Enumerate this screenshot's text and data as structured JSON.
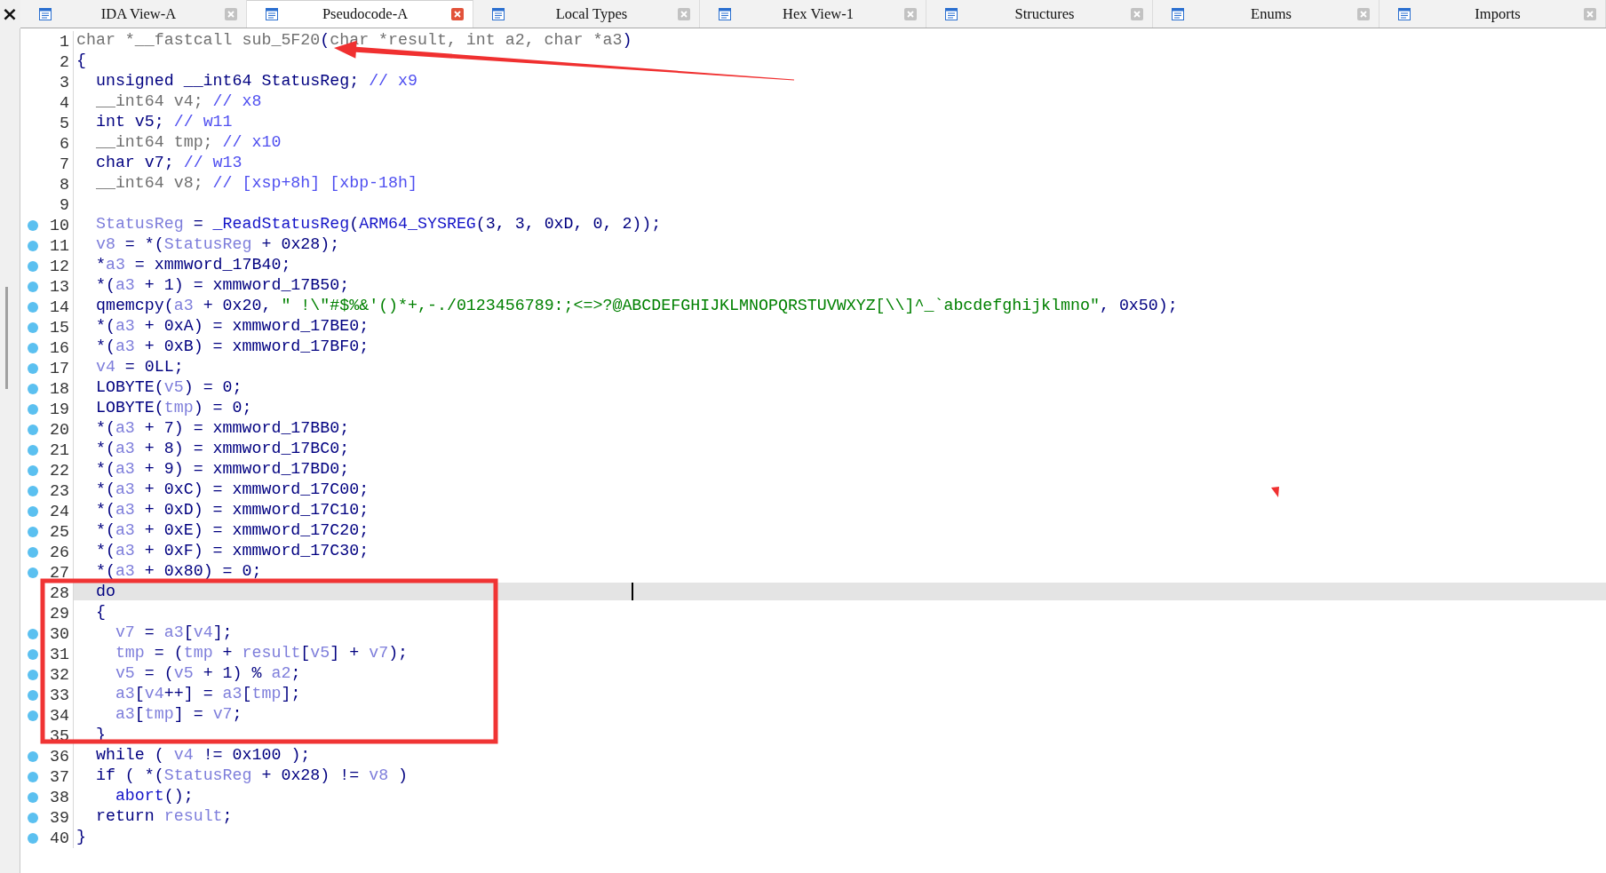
{
  "close_glyph": "×",
  "tabs": [
    {
      "label": "IDA View-A",
      "selected": false
    },
    {
      "label": "Pseudocode-A",
      "selected": true
    },
    {
      "label": "Local Types",
      "selected": false
    },
    {
      "label": "Hex View-1",
      "selected": false
    },
    {
      "label": "Structures",
      "selected": false
    },
    {
      "label": "Enums",
      "selected": false
    },
    {
      "label": "Imports",
      "selected": false
    }
  ],
  "lines": [
    {
      "number": "1",
      "marked": false,
      "selected": false,
      "tokens": [
        {
          "text": "char *__fastcall sub_5F20",
          "kind": "dim"
        },
        {
          "text": "(",
          "kind": "plain"
        },
        {
          "text": "char *result, int a2, char *a3",
          "kind": "dim"
        },
        {
          "text": ")",
          "kind": "plain"
        }
      ]
    },
    {
      "number": "2",
      "marked": false,
      "selected": false,
      "tokens": [
        {
          "text": "{",
          "kind": "plain"
        }
      ]
    },
    {
      "number": "3",
      "marked": false,
      "selected": false,
      "tokens": [
        {
          "text": "  unsigned __int64 StatusReg; ",
          "kind": "plain"
        },
        {
          "text": "// x9",
          "kind": "comment"
        }
      ]
    },
    {
      "number": "4",
      "marked": false,
      "selected": false,
      "tokens": [
        {
          "text": "  __int64 v4; ",
          "kind": "dim"
        },
        {
          "text": "// x8",
          "kind": "comment"
        }
      ]
    },
    {
      "number": "5",
      "marked": false,
      "selected": false,
      "tokens": [
        {
          "text": "  int v5; ",
          "kind": "plain"
        },
        {
          "text": "// w11",
          "kind": "comment"
        }
      ]
    },
    {
      "number": "6",
      "marked": false,
      "selected": false,
      "tokens": [
        {
          "text": "  __int64 tmp; ",
          "kind": "dim"
        },
        {
          "text": "// x10",
          "kind": "comment"
        }
      ]
    },
    {
      "number": "7",
      "marked": false,
      "selected": false,
      "tokens": [
        {
          "text": "  char v7; ",
          "kind": "plain"
        },
        {
          "text": "// w13",
          "kind": "comment"
        }
      ]
    },
    {
      "number": "8",
      "marked": false,
      "selected": false,
      "tokens": [
        {
          "text": "  __int64 v8; ",
          "kind": "dim"
        },
        {
          "text": "// [xsp+8h] [xbp-18h]",
          "kind": "comment"
        }
      ]
    },
    {
      "number": "9",
      "marked": false,
      "selected": false
    },
    {
      "number": "10",
      "marked": true,
      "selected": false,
      "tokens": [
        {
          "text": "  StatusReg",
          "kind": "var"
        },
        {
          "text": " = ",
          "kind": "plain"
        },
        {
          "text": "_ReadStatusReg",
          "kind": "func"
        },
        {
          "text": "(",
          "kind": "plain"
        },
        {
          "text": "ARM64_SYSREG",
          "kind": "func"
        },
        {
          "text": "(3, 3, 0xD, 0, 2));",
          "kind": "plain"
        }
      ]
    },
    {
      "number": "11",
      "marked": true,
      "selected": false,
      "tokens": [
        {
          "text": "  v8",
          "kind": "var"
        },
        {
          "text": " = *(",
          "kind": "plain"
        },
        {
          "text": "StatusReg",
          "kind": "var"
        },
        {
          "text": " + 0x28);",
          "kind": "plain"
        }
      ]
    },
    {
      "number": "12",
      "marked": true,
      "selected": false,
      "tokens": [
        {
          "text": "  *",
          "kind": "plain"
        },
        {
          "text": "a3",
          "kind": "var"
        },
        {
          "text": " = xmmword_17B40;",
          "kind": "plain"
        }
      ]
    },
    {
      "number": "13",
      "marked": true,
      "selected": false,
      "tokens": [
        {
          "text": "  *(",
          "kind": "plain"
        },
        {
          "text": "a3",
          "kind": "var"
        },
        {
          "text": " + 1) = xmmword_17B50;",
          "kind": "plain"
        }
      ]
    },
    {
      "number": "14",
      "marked": true,
      "selected": false,
      "tokens": [
        {
          "text": "  qmemcpy(",
          "kind": "plain"
        },
        {
          "text": "a3",
          "kind": "var"
        },
        {
          "text": " + 0x20, ",
          "kind": "plain"
        },
        {
          "text": "\" !\\\"#$%&'()*+,-./0123456789:;<=>?@ABCDEFGHIJKLMNOPQRSTUVWXYZ[\\\\]^_`abcdefghijklmno\"",
          "kind": "str"
        },
        {
          "text": ", 0x50);",
          "kind": "plain"
        }
      ]
    },
    {
      "number": "15",
      "marked": true,
      "selected": false,
      "tokens": [
        {
          "text": "  *(",
          "kind": "plain"
        },
        {
          "text": "a3",
          "kind": "var"
        },
        {
          "text": " + 0xA) = xmmword_17BE0;",
          "kind": "plain"
        }
      ]
    },
    {
      "number": "16",
      "marked": true,
      "selected": false,
      "tokens": [
        {
          "text": "  *(",
          "kind": "plain"
        },
        {
          "text": "a3",
          "kind": "var"
        },
        {
          "text": " + 0xB) = xmmword_17BF0;",
          "kind": "plain"
        }
      ]
    },
    {
      "number": "17",
      "marked": true,
      "selected": false,
      "tokens": [
        {
          "text": "  v4",
          "kind": "var"
        },
        {
          "text": " = 0LL;",
          "kind": "plain"
        }
      ]
    },
    {
      "number": "18",
      "marked": true,
      "selected": false,
      "tokens": [
        {
          "text": "  LOBYTE(",
          "kind": "plain"
        },
        {
          "text": "v5",
          "kind": "var"
        },
        {
          "text": ") = 0;",
          "kind": "plain"
        }
      ]
    },
    {
      "number": "19",
      "marked": true,
      "selected": false,
      "tokens": [
        {
          "text": "  LOBYTE(",
          "kind": "plain"
        },
        {
          "text": "tmp",
          "kind": "var"
        },
        {
          "text": ") = 0;",
          "kind": "plain"
        }
      ]
    },
    {
      "number": "20",
      "marked": true,
      "selected": false,
      "tokens": [
        {
          "text": "  *(",
          "kind": "plain"
        },
        {
          "text": "a3",
          "kind": "var"
        },
        {
          "text": " + 7) = xmmword_17BB0;",
          "kind": "plain"
        }
      ]
    },
    {
      "number": "21",
      "marked": true,
      "selected": false,
      "tokens": [
        {
          "text": "  *(",
          "kind": "plain"
        },
        {
          "text": "a3",
          "kind": "var"
        },
        {
          "text": " + 8) = xmmword_17BC0;",
          "kind": "plain"
        }
      ]
    },
    {
      "number": "22",
      "marked": true,
      "selected": false,
      "tokens": [
        {
          "text": "  *(",
          "kind": "plain"
        },
        {
          "text": "a3",
          "kind": "var"
        },
        {
          "text": " + 9) = xmmword_17BD0;",
          "kind": "plain"
        }
      ]
    },
    {
      "number": "23",
      "marked": true,
      "selected": false,
      "tokens": [
        {
          "text": "  *(",
          "kind": "plain"
        },
        {
          "text": "a3",
          "kind": "var"
        },
        {
          "text": " + 0xC) = xmmword_17C00;",
          "kind": "plain"
        }
      ]
    },
    {
      "number": "24",
      "marked": true,
      "selected": false,
      "tokens": [
        {
          "text": "  *(",
          "kind": "plain"
        },
        {
          "text": "a3",
          "kind": "var"
        },
        {
          "text": " + 0xD) = xmmword_17C10;",
          "kind": "plain"
        }
      ]
    },
    {
      "number": "25",
      "marked": true,
      "selected": false,
      "tokens": [
        {
          "text": "  *(",
          "kind": "plain"
        },
        {
          "text": "a3",
          "kind": "var"
        },
        {
          "text": " + 0xE) = xmmword_17C20;",
          "kind": "plain"
        }
      ]
    },
    {
      "number": "26",
      "marked": true,
      "selected": false,
      "tokens": [
        {
          "text": "  *(",
          "kind": "plain"
        },
        {
          "text": "a3",
          "kind": "var"
        },
        {
          "text": " + 0xF) = xmmword_17C30;",
          "kind": "plain"
        }
      ]
    },
    {
      "number": "27",
      "marked": true,
      "selected": false,
      "tokens": [
        {
          "text": "  *(",
          "kind": "plain"
        },
        {
          "text": "a3",
          "kind": "var"
        },
        {
          "text": " + 0x80) = 0;",
          "kind": "plain"
        }
      ]
    },
    {
      "number": "28",
      "marked": false,
      "selected": true,
      "tokens": [
        {
          "text": "  do",
          "kind": "plain"
        }
      ]
    },
    {
      "number": "29",
      "marked": false,
      "selected": false,
      "tokens": [
        {
          "text": "  {",
          "kind": "plain"
        }
      ]
    },
    {
      "number": "30",
      "marked": true,
      "selected": false,
      "tokens": [
        {
          "text": "    v7",
          "kind": "var"
        },
        {
          "text": " = ",
          "kind": "plain"
        },
        {
          "text": "a3",
          "kind": "var"
        },
        {
          "text": "[",
          "kind": "plain"
        },
        {
          "text": "v4",
          "kind": "var"
        },
        {
          "text": "];",
          "kind": "plain"
        }
      ]
    },
    {
      "number": "31",
      "marked": true,
      "selected": false,
      "tokens": [
        {
          "text": "    tmp",
          "kind": "var"
        },
        {
          "text": " = (",
          "kind": "plain"
        },
        {
          "text": "tmp",
          "kind": "var"
        },
        {
          "text": " + ",
          "kind": "plain"
        },
        {
          "text": "result",
          "kind": "var"
        },
        {
          "text": "[",
          "kind": "plain"
        },
        {
          "text": "v5",
          "kind": "var"
        },
        {
          "text": "] + ",
          "kind": "plain"
        },
        {
          "text": "v7",
          "kind": "var"
        },
        {
          "text": ");",
          "kind": "plain"
        }
      ]
    },
    {
      "number": "32",
      "marked": true,
      "selected": false,
      "tokens": [
        {
          "text": "    v5",
          "kind": "var"
        },
        {
          "text": " = (",
          "kind": "plain"
        },
        {
          "text": "v5",
          "kind": "var"
        },
        {
          "text": " + 1) % ",
          "kind": "plain"
        },
        {
          "text": "a2",
          "kind": "var"
        },
        {
          "text": ";",
          "kind": "plain"
        }
      ]
    },
    {
      "number": "33",
      "marked": true,
      "selected": false,
      "tokens": [
        {
          "text": "    a3",
          "kind": "var"
        },
        {
          "text": "[",
          "kind": "plain"
        },
        {
          "text": "v4",
          "kind": "var"
        },
        {
          "text": "++] = ",
          "kind": "plain"
        },
        {
          "text": "a3",
          "kind": "var"
        },
        {
          "text": "[",
          "kind": "plain"
        },
        {
          "text": "tmp",
          "kind": "var"
        },
        {
          "text": "];",
          "kind": "plain"
        }
      ]
    },
    {
      "number": "34",
      "marked": true,
      "selected": false,
      "tokens": [
        {
          "text": "    a3",
          "kind": "var"
        },
        {
          "text": "[",
          "kind": "plain"
        },
        {
          "text": "tmp",
          "kind": "var"
        },
        {
          "text": "] = ",
          "kind": "plain"
        },
        {
          "text": "v7",
          "kind": "var"
        },
        {
          "text": ";",
          "kind": "plain"
        }
      ]
    },
    {
      "number": "35",
      "marked": false,
      "selected": false,
      "tokens": [
        {
          "text": "  }",
          "kind": "plain"
        }
      ]
    },
    {
      "number": "36",
      "marked": true,
      "selected": false,
      "tokens": [
        {
          "text": "  while ( ",
          "kind": "plain"
        },
        {
          "text": "v4",
          "kind": "var"
        },
        {
          "text": " != 0x100 );",
          "kind": "plain"
        }
      ]
    },
    {
      "number": "37",
      "marked": true,
      "selected": false,
      "tokens": [
        {
          "text": "  if ( *(",
          "kind": "plain"
        },
        {
          "text": "StatusReg",
          "kind": "var"
        },
        {
          "text": " + 0x28) != ",
          "kind": "plain"
        },
        {
          "text": "v8",
          "kind": "var"
        },
        {
          "text": " )",
          "kind": "plain"
        }
      ]
    },
    {
      "number": "38",
      "marked": true,
      "selected": false,
      "tokens": [
        {
          "text": "    abort",
          "kind": "func"
        },
        {
          "text": "();",
          "kind": "plain"
        }
      ]
    },
    {
      "number": "39",
      "marked": true,
      "selected": false,
      "tokens": [
        {
          "text": "  return ",
          "kind": "plain"
        },
        {
          "text": "result",
          "kind": "var"
        },
        {
          "text": ";",
          "kind": "plain"
        }
      ]
    },
    {
      "number": "40",
      "marked": true,
      "selected": false,
      "tokens": [
        {
          "text": "}",
          "kind": "plain"
        }
      ]
    }
  ],
  "annotations": [
    {
      "kind": "arrow"
    },
    {
      "kind": "frame"
    },
    {
      "kind": "pointer"
    }
  ]
}
